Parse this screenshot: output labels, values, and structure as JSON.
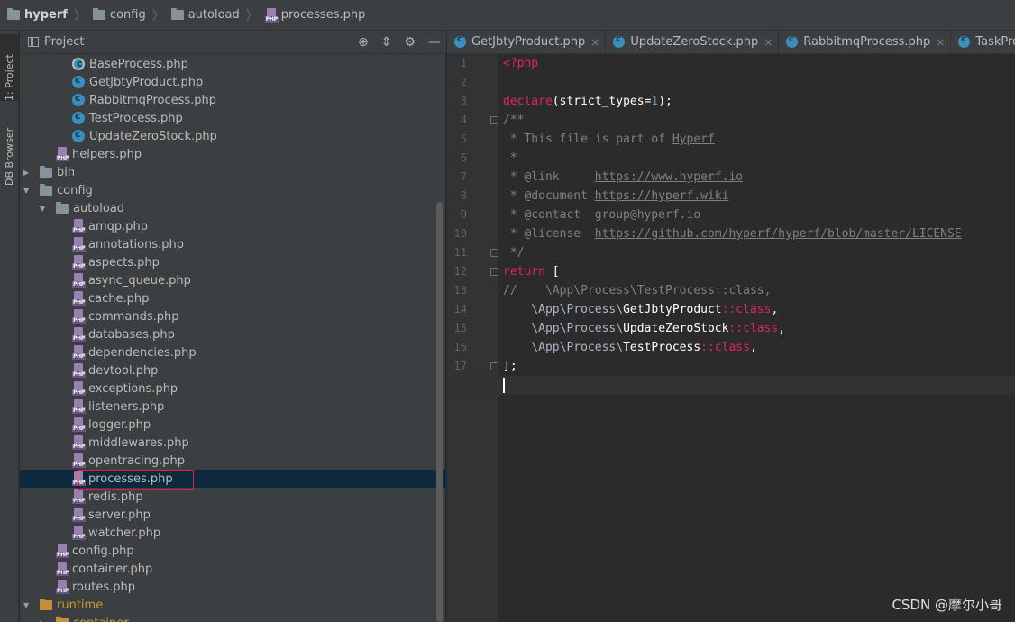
{
  "breadcrumb": {
    "root": "hyperf",
    "seg1": "config",
    "seg2": "autoload",
    "file": "processes.php"
  },
  "left_strip": {
    "project_tab": "1: Project",
    "db_tab": "DB Browser"
  },
  "project_panel": {
    "title": "Project",
    "tree": [
      {
        "label": "BaseProcess.php",
        "icon": "abstract-class-icon",
        "indent": 3
      },
      {
        "label": "GetJbtyProduct.php",
        "icon": "class-icon",
        "indent": 3
      },
      {
        "label": "RabbitmqProcess.php",
        "icon": "class-icon",
        "indent": 3
      },
      {
        "label": "TestProcess.php",
        "icon": "class-icon",
        "indent": 3
      },
      {
        "label": "UpdateZeroStock.php",
        "icon": "class-icon",
        "indent": 3
      },
      {
        "label": "helpers.php",
        "icon": "php-file-icon",
        "indent": 2
      },
      {
        "label": "bin",
        "icon": "folder-icon",
        "indent": 1,
        "arrow": "collapsed"
      },
      {
        "label": "config",
        "icon": "folder-icon",
        "indent": 1,
        "arrow": "expanded"
      },
      {
        "label": "autoload",
        "icon": "folder-icon",
        "indent": 2,
        "arrow": "expanded"
      },
      {
        "label": "amqp.php",
        "icon": "php-file-icon",
        "indent": 3
      },
      {
        "label": "annotations.php",
        "icon": "php-file-icon",
        "indent": 3
      },
      {
        "label": "aspects.php",
        "icon": "php-file-icon",
        "indent": 3
      },
      {
        "label": "async_queue.php",
        "icon": "php-file-icon",
        "indent": 3
      },
      {
        "label": "cache.php",
        "icon": "php-file-icon",
        "indent": 3
      },
      {
        "label": "commands.php",
        "icon": "php-file-icon",
        "indent": 3
      },
      {
        "label": "databases.php",
        "icon": "php-file-icon",
        "indent": 3
      },
      {
        "label": "dependencies.php",
        "icon": "php-file-icon",
        "indent": 3
      },
      {
        "label": "devtool.php",
        "icon": "php-file-icon",
        "indent": 3
      },
      {
        "label": "exceptions.php",
        "icon": "php-file-icon",
        "indent": 3
      },
      {
        "label": "listeners.php",
        "icon": "php-file-icon",
        "indent": 3
      },
      {
        "label": "logger.php",
        "icon": "php-file-icon",
        "indent": 3
      },
      {
        "label": "middlewares.php",
        "icon": "php-file-icon",
        "indent": 3
      },
      {
        "label": "opentracing.php",
        "icon": "php-file-icon",
        "indent": 3
      },
      {
        "label": "processes.php",
        "icon": "php-file-icon",
        "indent": 3,
        "selected": true
      },
      {
        "label": "redis.php",
        "icon": "php-file-icon",
        "indent": 3
      },
      {
        "label": "server.php",
        "icon": "php-file-icon",
        "indent": 3
      },
      {
        "label": "watcher.php",
        "icon": "php-file-icon",
        "indent": 3
      },
      {
        "label": "config.php",
        "icon": "php-file-icon",
        "indent": 2
      },
      {
        "label": "container.php",
        "icon": "php-file-icon",
        "indent": 2
      },
      {
        "label": "routes.php",
        "icon": "php-file-icon",
        "indent": 2
      },
      {
        "label": "runtime",
        "icon": "folder-icon",
        "indent": 1,
        "arrow": "expanded",
        "orange": true
      },
      {
        "label": "container",
        "icon": "folder-icon",
        "indent": 2,
        "arrow": "collapsed",
        "orange": true
      }
    ]
  },
  "editor_tabs": [
    {
      "label": "GetJbtyProduct.php",
      "close": "×"
    },
    {
      "label": "UpdateZeroStock.php",
      "close": "×"
    },
    {
      "label": "RabbitmqProcess.php",
      "close": "×"
    },
    {
      "label": "TaskProcessCo",
      "close": ""
    }
  ],
  "editor": {
    "line_numbers": [
      "1",
      "2",
      "3",
      "4",
      "5",
      "6",
      "7",
      "8",
      "9",
      "10",
      "11",
      "12",
      "13",
      "14",
      "15",
      "16",
      "17",
      "18"
    ],
    "current_line": 18,
    "lines": [
      [
        {
          "t": "<?php",
          "c": "kw2"
        }
      ],
      [],
      [
        {
          "t": "declare",
          "c": "kw2"
        },
        {
          "t": "(strict_types=",
          "c": "wht"
        },
        {
          "t": "1",
          "c": "num"
        },
        {
          "t": ");",
          "c": "wht"
        }
      ],
      [
        {
          "t": "/**",
          "c": "cmt"
        }
      ],
      [
        {
          "t": " * This file is part of ",
          "c": "cmt"
        },
        {
          "t": "Hyperf",
          "c": "link"
        },
        {
          "t": ".",
          "c": "cmt"
        }
      ],
      [
        {
          "t": " *",
          "c": "cmt"
        }
      ],
      [
        {
          "t": " * @link     ",
          "c": "cmt"
        },
        {
          "t": "https://www.hyperf.io",
          "c": "link"
        }
      ],
      [
        {
          "t": " * @document ",
          "c": "cmt"
        },
        {
          "t": "https://hyperf.wiki",
          "c": "link"
        }
      ],
      [
        {
          "t": " * @contact  group@hyperf.io",
          "c": "cmt"
        }
      ],
      [
        {
          "t": " * @license  ",
          "c": "cmt"
        },
        {
          "t": "https://github.com/hyperf/hyperf/blob/master/LICENSE",
          "c": "link"
        }
      ],
      [
        {
          "t": " */",
          "c": "cmt"
        }
      ],
      [
        {
          "t": "return",
          "c": "kw2"
        },
        {
          "t": " [",
          "c": "wht"
        }
      ],
      [
        {
          "t": "//    \\App\\Process\\TestProcess::class,",
          "c": "cmt"
        }
      ],
      [
        {
          "t": "    \\App\\Process\\",
          "c": "plain"
        },
        {
          "t": "GetJbtyProduct",
          "c": "wht"
        },
        {
          "t": "::class",
          "c": "kw2"
        },
        {
          "t": ",",
          "c": "wht"
        }
      ],
      [
        {
          "t": "    \\App\\Process\\",
          "c": "plain"
        },
        {
          "t": "UpdateZeroStock",
          "c": "wht"
        },
        {
          "t": "::class",
          "c": "kw2"
        },
        {
          "t": ",",
          "c": "wht"
        }
      ],
      [
        {
          "t": "    \\App\\Process\\",
          "c": "plain"
        },
        {
          "t": "TestProcess",
          "c": "wht"
        },
        {
          "t": "::class",
          "c": "kw2"
        },
        {
          "t": ",",
          "c": "wht"
        }
      ],
      [
        {
          "t": "];",
          "c": "wht"
        }
      ],
      []
    ]
  },
  "watermark": "CSDN @摩尔小哥",
  "colors": {
    "selection_border": "#e0242b",
    "selected_row": "#0d293e",
    "keyword": "#e0245f",
    "number": "#6897bb",
    "comment": "#808080"
  }
}
